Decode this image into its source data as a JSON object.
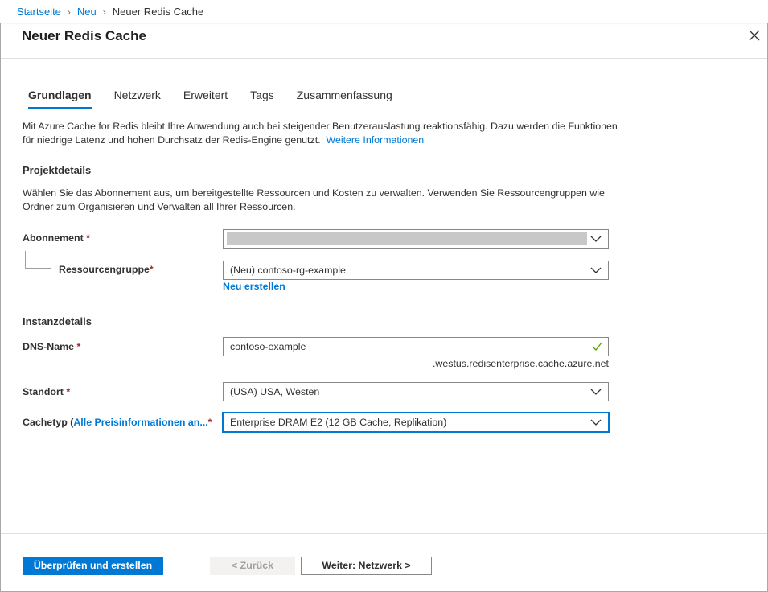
{
  "breadcrumb": {
    "items": [
      "Startseite",
      "Neu"
    ],
    "current": "Neuer Redis Cache"
  },
  "panel": {
    "title": "Neuer Redis Cache"
  },
  "tabs": [
    {
      "label": "Grundlagen",
      "active": true
    },
    {
      "label": "Netzwerk",
      "active": false
    },
    {
      "label": "Erweitert",
      "active": false
    },
    {
      "label": "Tags",
      "active": false
    },
    {
      "label": "Zusammenfassung",
      "active": false
    }
  ],
  "intro": {
    "text": "Mit Azure Cache for Redis bleibt Ihre Anwendung auch bei steigender Benutzerauslastung reaktionsfähig. Dazu werden die Funktionen für niedrige Latenz und hohen Durchsatz der Redis-Engine genutzt.",
    "link": "Weitere Informationen"
  },
  "project": {
    "heading": "Projektdetails",
    "text": "Wählen Sie das Abonnement aus, um bereitgestellte Ressourcen und Kosten zu verwalten. Verwenden Sie Ressourcengruppen wie Ordner zum Organisieren und Verwalten all Ihrer Ressourcen.",
    "subscription_label": "Abonnement",
    "resource_group_label": "Ressourcengruppe",
    "resource_group_value": "(Neu)  contoso-rg-example",
    "create_new": "Neu erstellen"
  },
  "instance": {
    "heading": "Instanzdetails",
    "dns_label": "DNS-Name",
    "dns_value": "contoso-example",
    "dns_suffix": ".westus.redisenterprise.cache.azure.net",
    "location_label": "Standort",
    "location_value": "(USA) USA, Westen",
    "cache_type_label_prefix": "Cachetyp (",
    "cache_type_link": "Alle Preisinformationen an...",
    "cache_type_value": "Enterprise DRAM E2 (12 GB Cache, Replikation)"
  },
  "required_marker": "*",
  "footer": {
    "review_create": "Überprüfen und erstellen",
    "previous": "< Zurück",
    "next": "Weiter: Netzwerk >"
  },
  "colors": {
    "accent": "#0078d4",
    "required": "#a4262c",
    "valid": "#57a300"
  },
  "icons": {
    "close": "close-icon",
    "dropdown": "chevron-down-icon",
    "valid": "checkmark-icon",
    "breadcrumb_separator": "chevron-right-icon"
  }
}
